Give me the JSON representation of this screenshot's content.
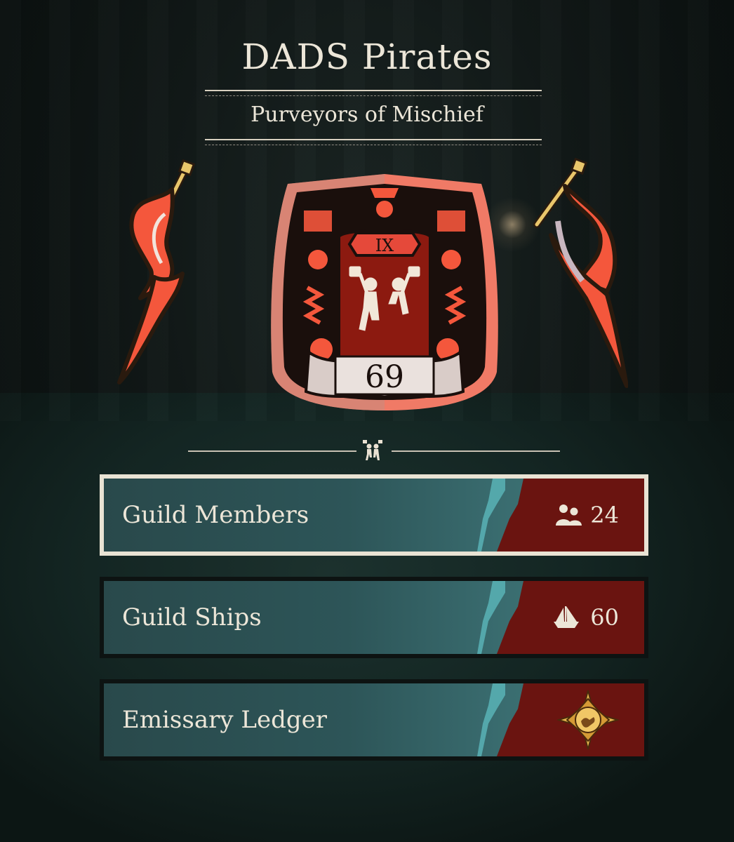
{
  "guild": {
    "name": "DADS Pirates",
    "motto": "Purveyors of Mischief",
    "rank_numeral": "IX",
    "level": "69"
  },
  "menu": [
    {
      "label": "Guild Members",
      "value": "24",
      "icon": "crew-icon"
    },
    {
      "label": "Guild Ships",
      "value": "60",
      "icon": "ship-icon"
    },
    {
      "label": "Emissary Ledger",
      "value": "",
      "icon": "emissary-compass-icon"
    }
  ],
  "colors": {
    "banner_red": "#f4573c",
    "panel_teal": "#2d5558",
    "panel_red": "#6a1410",
    "cream_text": "#ece6d8",
    "gold": "#e9c66b"
  }
}
